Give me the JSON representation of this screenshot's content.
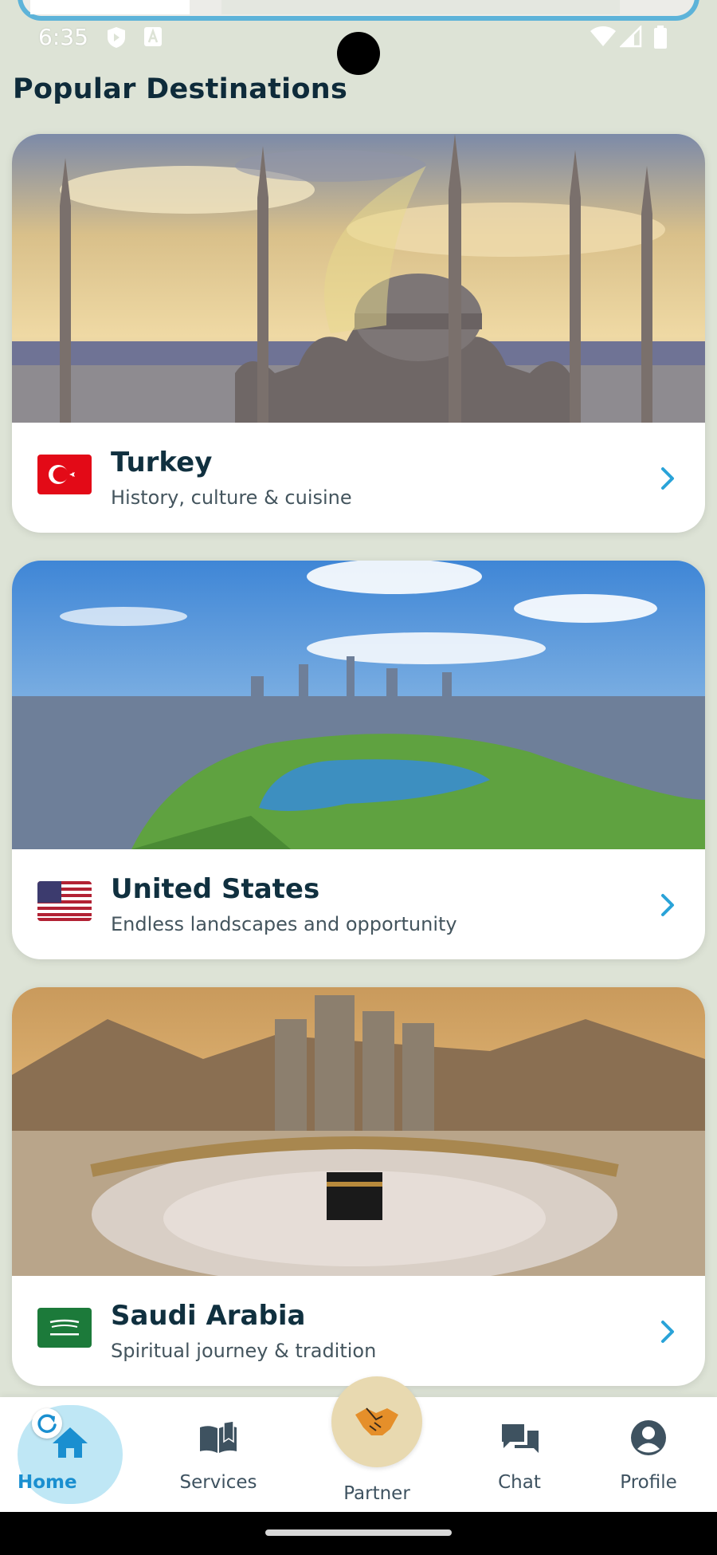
{
  "status_bar": {
    "time": "6:35",
    "left_icons": [
      "shield-icon",
      "font-a-icon"
    ],
    "right_icons": [
      "wifi-icon",
      "signal-icon",
      "battery-icon"
    ]
  },
  "main": {
    "section_title": "Popular Destinations",
    "destinations": [
      {
        "name": "Turkey",
        "subtitle": "History, culture & cuisine",
        "flag": "turkey-flag-icon",
        "image": "blue-mosque-istanbul-photo"
      },
      {
        "name": "United States",
        "subtitle": "Endless landscapes and opportunity",
        "flag": "us-flag-icon",
        "image": "central-park-new-york-photo"
      },
      {
        "name": "Saudi Arabia",
        "subtitle": "Spiritual journey & tradition",
        "flag": "saudi-flag-icon",
        "image": "kaaba-mecca-photo"
      }
    ]
  },
  "bottom_nav": {
    "items": [
      {
        "label": "Home",
        "icon": "home-icon",
        "active": true
      },
      {
        "label": "Services",
        "icon": "open-book-icon",
        "active": false
      },
      {
        "label": "Partner",
        "icon": "handshake-icon",
        "active": false
      },
      {
        "label": "Chat",
        "icon": "chat-bubbles-icon",
        "active": false
      },
      {
        "label": "Profile",
        "icon": "user-circle-icon",
        "active": false
      }
    ]
  },
  "colors": {
    "background": "#dde3d6",
    "accent": "#2aa3d8",
    "active_bubble": "#bfe7f5",
    "text_dark": "#10303f",
    "partner_circle": "#e8d9b0"
  }
}
